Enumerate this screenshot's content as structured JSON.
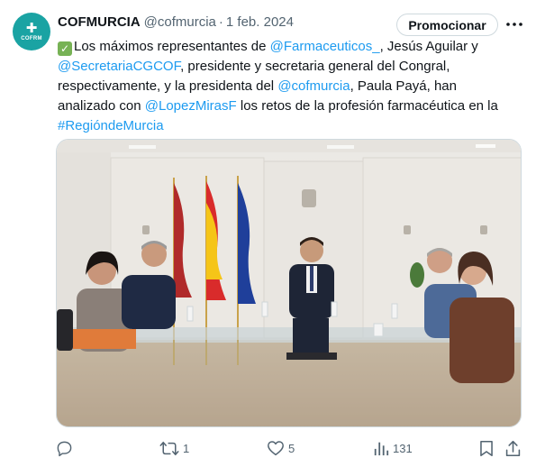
{
  "account": {
    "name": "COFMURCIA",
    "handle": "@cofmurcia",
    "separator": "·",
    "date": "1 feb. 2024",
    "avatar_label": "COFRM"
  },
  "promote_button": "Promocionar",
  "tweet": {
    "parts": [
      {
        "text": "Los máximos representantes de ",
        "link": false
      },
      {
        "text": "@Farmaceuticos_",
        "link": true
      },
      {
        "text": ", Jesús Aguilar y ",
        "link": false
      },
      {
        "text": "@SecretariaCGCOF",
        "link": true
      },
      {
        "text": ", presidente y secretaria general del Congral, respectivamente, y la presidenta del ",
        "link": false
      },
      {
        "text": "@cofmurcia",
        "link": true
      },
      {
        "text": ", Paula Payá, han analizado con ",
        "link": false
      },
      {
        "text": "@LopezMirasF",
        "link": true
      },
      {
        "text": " los retos de la profesión farmacéutica en la ",
        "link": false
      },
      {
        "text": "#RegióndeMurcia",
        "link": true
      }
    ]
  },
  "actions": {
    "reply_count": "",
    "retweet_count": "1",
    "like_count": "5",
    "views_count": "131"
  },
  "colors": {
    "link": "#1d9bf0",
    "muted": "#536471",
    "avatar": "#1aa3a3"
  }
}
